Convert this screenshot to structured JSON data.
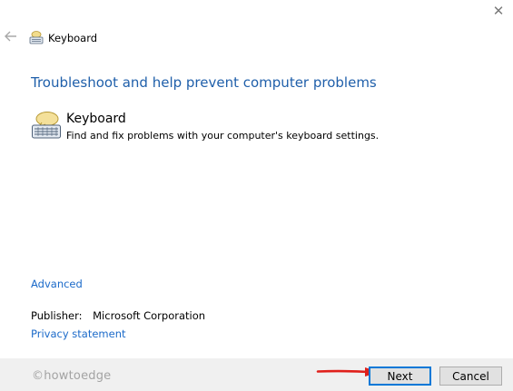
{
  "window": {
    "title": "Keyboard",
    "close_glyph": "✕"
  },
  "main": {
    "heading": "Troubleshoot and help prevent computer problems",
    "item": {
      "title": "Keyboard",
      "description": "Find and fix problems with your computer's keyboard settings.",
      "icon": "keyboard-icon"
    },
    "advanced_link": "Advanced",
    "publisher_label": "Publisher:",
    "publisher_value": "Microsoft Corporation",
    "privacy_link": "Privacy statement"
  },
  "footer": {
    "watermark": "©howtoedge",
    "next_label": "Next",
    "cancel_label": "Cancel"
  },
  "colors": {
    "heading": "#1f5faa",
    "link": "#1b6ac9",
    "footer_bg": "#f0f0f0",
    "focus_border": "#0078d7",
    "annotation_arrow": "#e0201b"
  }
}
